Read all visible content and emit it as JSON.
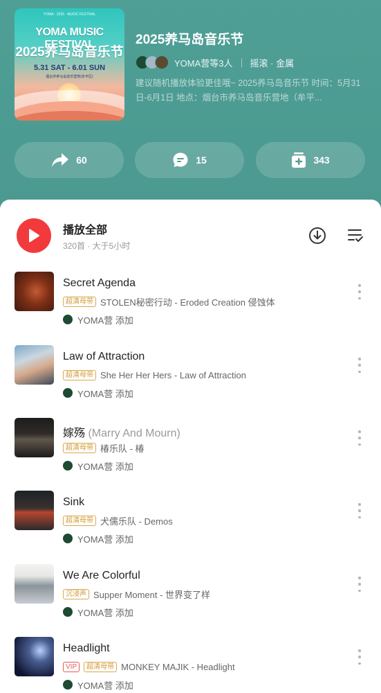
{
  "cover": {
    "small_text": "YOMA · 2025 · MUSIC FESTIVAL",
    "title_en": "YOMA MUSIC FESTIVAL",
    "title_cn": "2025养马岛音乐节",
    "dates": "5.31 SAT - 6.01 SUN",
    "location": "烟台市养马岛音乐营地(牟平区)"
  },
  "playlist": {
    "title": "2025养马岛音乐节",
    "creator": "YOMA营等3人",
    "genre": "摇滚 · 金属",
    "description": "建议随机播放体验更佳哦~ 2025养马岛音乐节 时间：5月31日-6月1日 地点：烟台市养马岛音乐营地（牟平..."
  },
  "actions": {
    "share_count": "60",
    "comment_count": "15",
    "collect_count": "343"
  },
  "list_header": {
    "play_all": "播放全部",
    "meta": "320首 · 大于5小时"
  },
  "tracks": [
    {
      "title": "Secret Agenda",
      "alt_title": "",
      "tags": [
        "超清母带"
      ],
      "subtitle": "STOLEN秘密行动 - Eroded Creation 侵蚀体",
      "added_by": "YOMA营 添加"
    },
    {
      "title": "Law of Attraction",
      "alt_title": "",
      "tags": [
        "超清母带"
      ],
      "subtitle": "She Her Her Hers - Law of Attraction",
      "added_by": "YOMA营 添加"
    },
    {
      "title": "嫁殇",
      "alt_title": "(Marry And Mourn)",
      "tags": [
        "超清母带"
      ],
      "subtitle": "椿乐队 - 椿",
      "added_by": "YOMA营 添加"
    },
    {
      "title": "Sink",
      "alt_title": "",
      "tags": [
        "超清母带"
      ],
      "subtitle": "犬儒乐队 - Demos",
      "added_by": "YOMA营 添加"
    },
    {
      "title": "We Are Colorful",
      "alt_title": "",
      "tags": [
        "沉浸声"
      ],
      "subtitle": "Supper Moment - 世界变了样",
      "added_by": "YOMA营 添加"
    },
    {
      "title": "Headlight",
      "alt_title": "",
      "tags": [
        "VIP",
        "超清母带"
      ],
      "subtitle": "MONKEY MAJIK - Headlight",
      "added_by": "YOMA营 添加"
    }
  ],
  "colors": {
    "header_bg": "#4d9e95",
    "play_red": "#f23a3c",
    "tag_gold": "#d39a34",
    "tag_vip": "#e55a55"
  }
}
